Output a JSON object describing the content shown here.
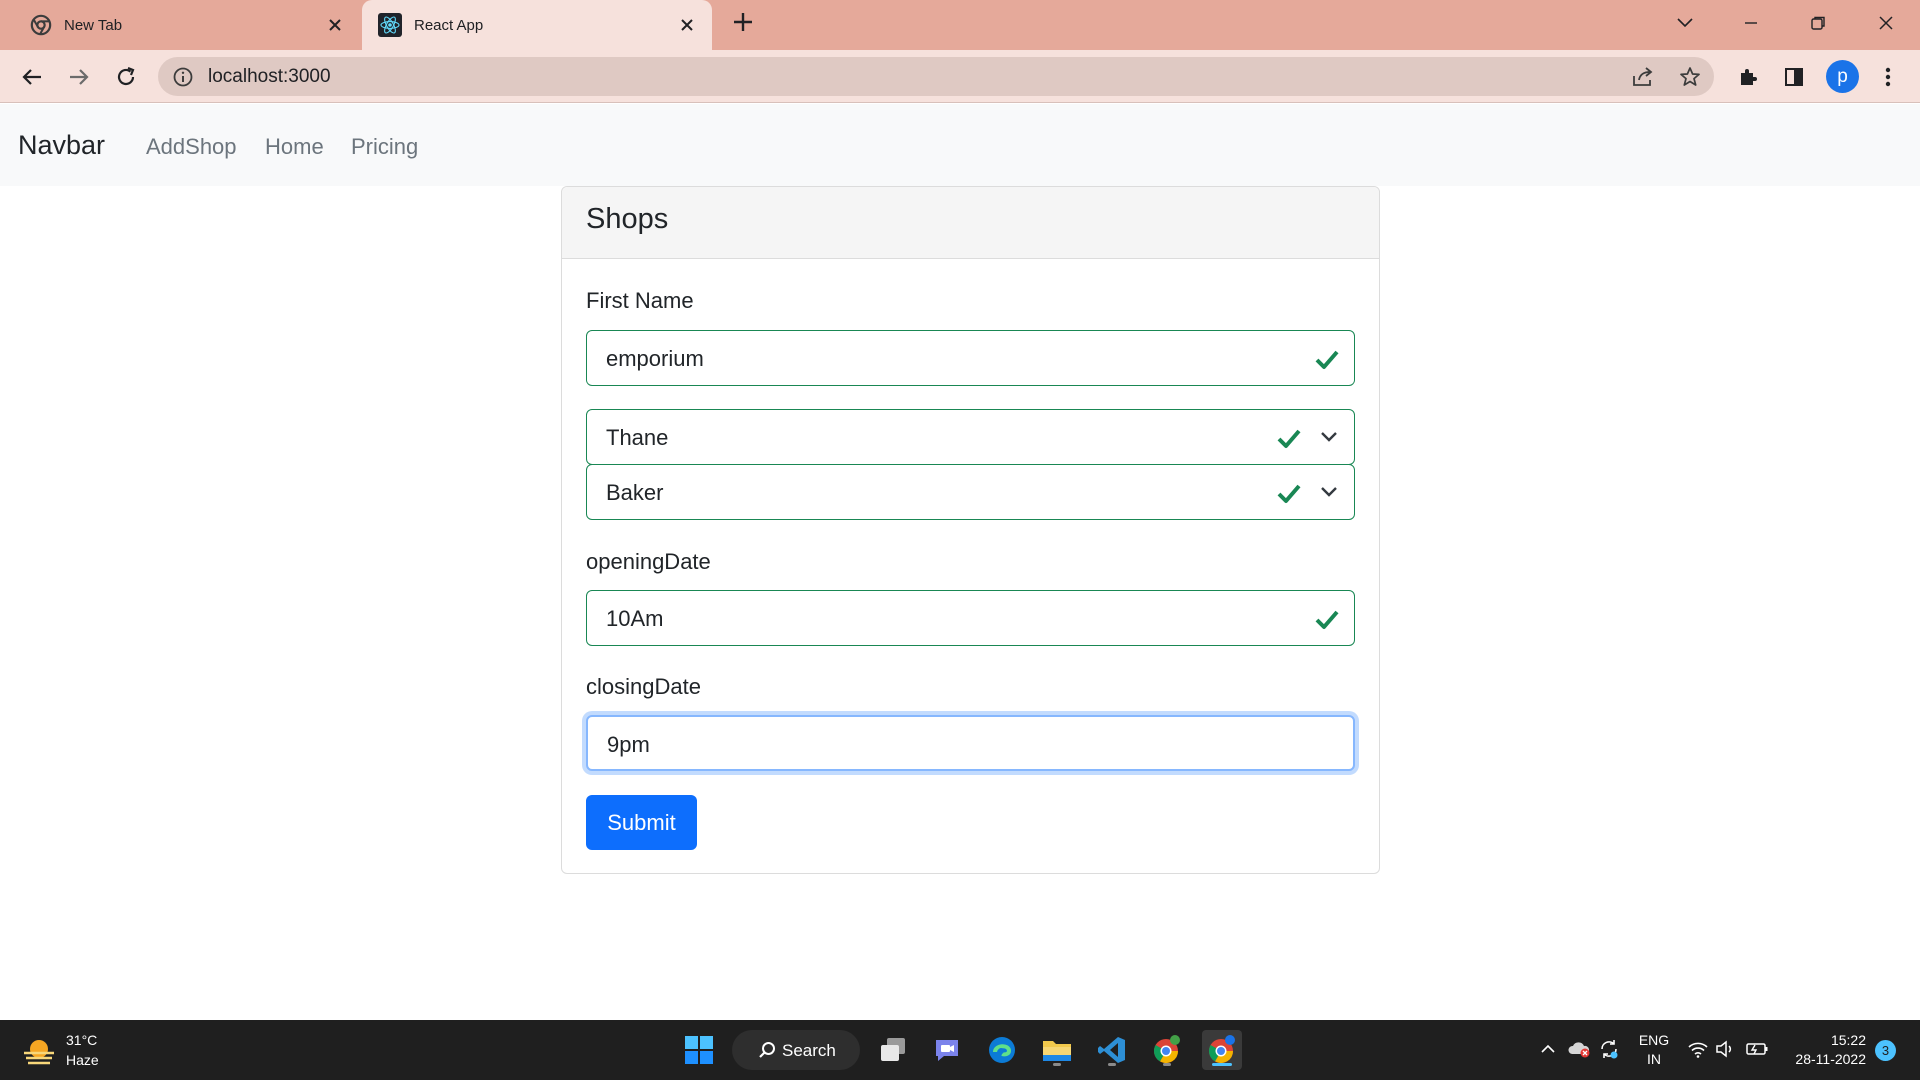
{
  "browser": {
    "tabs": [
      {
        "title": "New Tab",
        "active": false
      },
      {
        "title": "React App",
        "active": true
      }
    ],
    "address": "localhost:3000",
    "profile_initial": "p"
  },
  "navbar": {
    "brand": "Navbar",
    "links": [
      "AddShop",
      "Home",
      "Pricing"
    ]
  },
  "card": {
    "title": "Shops",
    "first_name_label": "First Name",
    "first_name_value": "emporium",
    "city_value": "Thane",
    "category_value": "Baker",
    "opening_label": "openingDate",
    "opening_value": "10Am",
    "closing_label": "closingDate",
    "closing_value": "9pm",
    "submit_label": "Submit"
  },
  "colors": {
    "valid": "#198754",
    "primary": "#0d6efd",
    "tabstrip": "#e5a99a"
  },
  "taskbar": {
    "weather_temp": "31°C",
    "weather_condition": "Haze",
    "search_label": "Search",
    "lang_line1": "ENG",
    "lang_line2": "IN",
    "time": "15:22",
    "date": "28-11-2022",
    "notification_count": "3"
  }
}
